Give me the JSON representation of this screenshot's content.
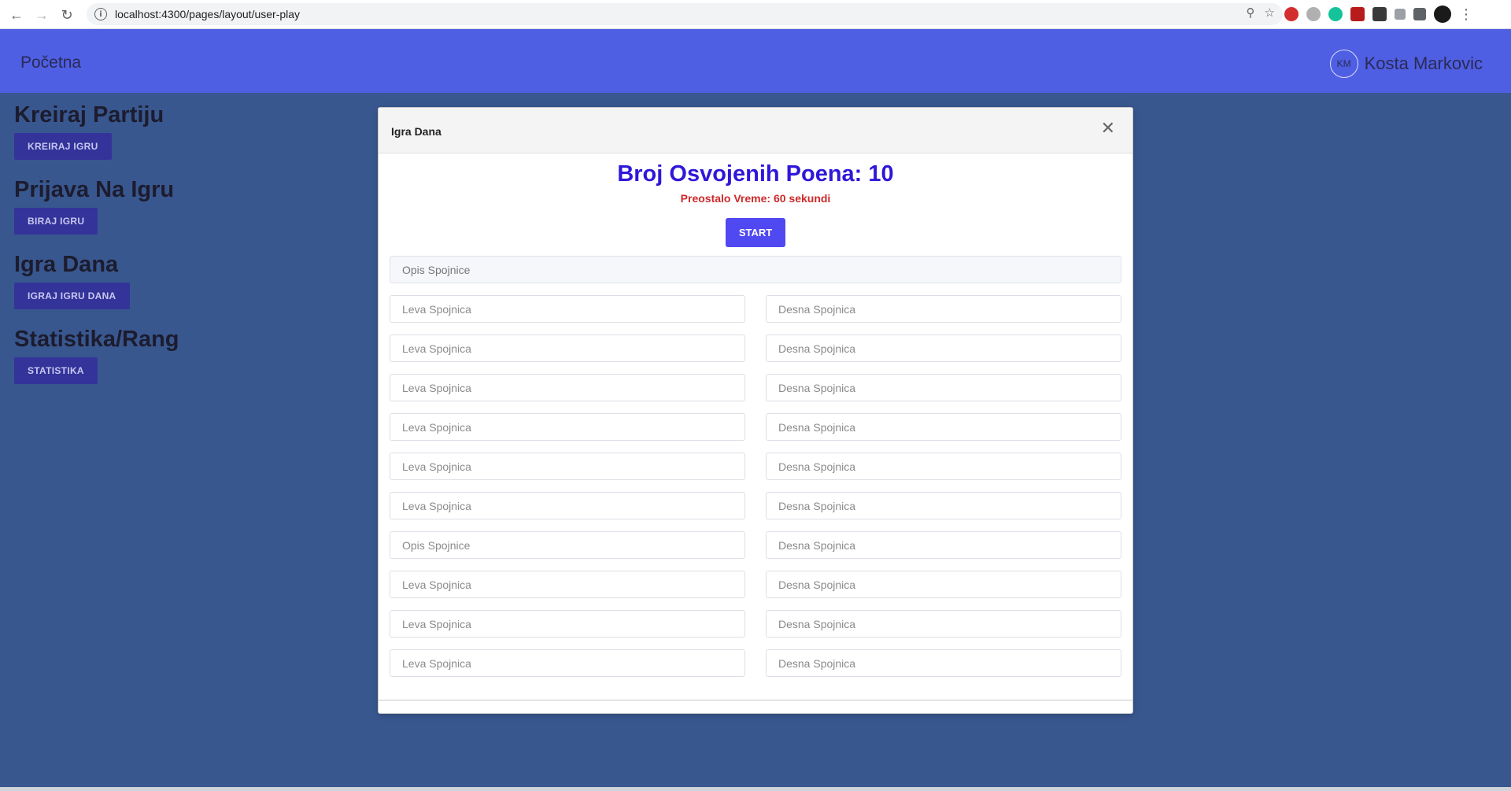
{
  "browser": {
    "url": "localhost:4300/pages/layout/user-play",
    "back_icon": "arrow-left-icon",
    "forward_icon": "arrow-right-icon",
    "reload_icon": "reload-icon"
  },
  "header": {
    "brand": "Početna",
    "user_initials": "KM",
    "user_name": "Kosta Markovic"
  },
  "sidebar": {
    "sections": [
      {
        "title": "Kreiraj Partiju",
        "button": "KREIRAJ IGRU"
      },
      {
        "title": "Prijava Na Igru",
        "button": "BIRAJ IGRU"
      },
      {
        "title": "Igra Dana",
        "button": "IGRAJ IGRU DANA"
      },
      {
        "title": "Statistika/Rang",
        "button": "STATISTIKA"
      }
    ]
  },
  "modal": {
    "title": "Igra Dana",
    "score": "Broj Osvojenih Poena: 10",
    "timer": "Preostalo Vreme: 60 sekundi",
    "start": "START",
    "description_placeholder": "Opis Spojnice",
    "rows": [
      {
        "left": "Leva Spojnica",
        "right": "Desna Spojnica"
      },
      {
        "left": "Leva Spojnica",
        "right": "Desna Spojnica"
      },
      {
        "left": "Leva Spojnica",
        "right": "Desna Spojnica"
      },
      {
        "left": "Leva Spojnica",
        "right": "Desna Spojnica"
      },
      {
        "left": "Leva Spojnica",
        "right": "Desna Spojnica"
      },
      {
        "left": "Leva Spojnica",
        "right": "Desna Spojnica"
      },
      {
        "left": "Opis Spojnice",
        "right": "Desna Spojnica"
      },
      {
        "left": "Leva Spojnica",
        "right": "Desna Spojnica"
      },
      {
        "left": "Leva Spojnica",
        "right": "Desna Spojnica"
      },
      {
        "left": "Leva Spojnica",
        "right": "Desna Spojnica"
      }
    ]
  },
  "colors": {
    "header_bg": "#4f5fe3",
    "page_bg": "#39578f",
    "score_color": "#2f17d9",
    "timer_color": "#cc2a2a",
    "start_bg": "#5048f0",
    "sidebar_button_bg": "#33339a"
  }
}
